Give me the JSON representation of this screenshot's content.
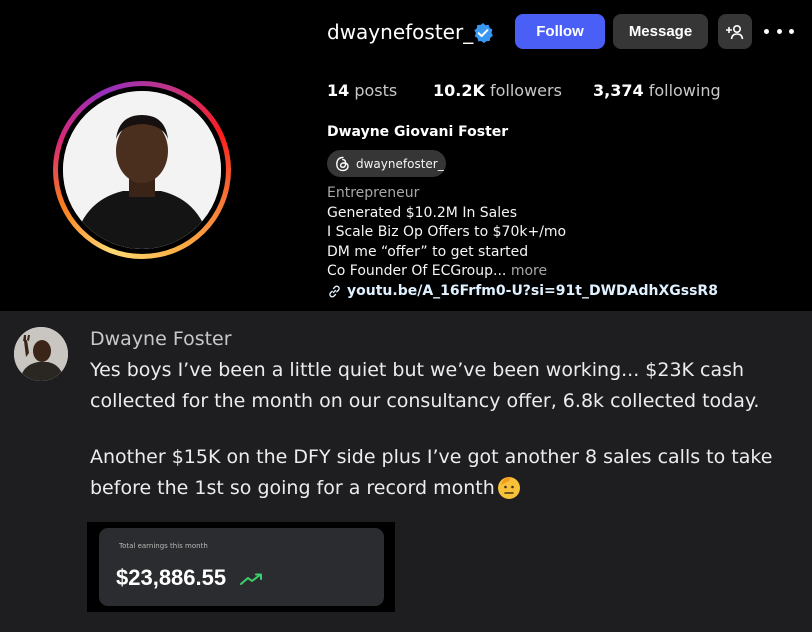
{
  "profile": {
    "username": "dwaynefoster_",
    "follow_label": "Follow",
    "message_label": "Message",
    "stats": {
      "posts_count": "14",
      "posts_label": "posts",
      "followers_count": "10.2K",
      "followers_label": "followers",
      "following_count": "3,374",
      "following_label": "following"
    },
    "full_name": "Dwayne Giovani Foster",
    "threads_handle": "dwaynefoster_",
    "bio": {
      "category": "Entrepreneur",
      "line1": "Generated $10.2M In Sales",
      "line2": "I Scale Biz Op Offers to $70k+/mo",
      "line3": "DM me “offer” to get started",
      "line4": "Co Founder Of ECGroup...",
      "more_label": "more"
    },
    "link": "youtu.be/A_16Frfm0-U?si=91t_DWDAdhXGssR8"
  },
  "post": {
    "author": "Dwayne Foster",
    "paragraph1": "Yes boys I’ve been a little quiet but we’ve been working... $23K cash collected for the month on our consultancy offer, 6.8k collected today.",
    "paragraph2": "Another $15K on the DFY side plus I’ve got another 8 sales calls to take before the 1st so going for a record month",
    "earnings_card": {
      "label": "Total earnings this month",
      "amount": "$23,886.55"
    }
  },
  "icons": {
    "verified": "verified-badge-icon",
    "suggest": "add-person-icon",
    "more": "more-options-icon",
    "threads": "threads-icon",
    "link": "link-icon",
    "emoji": "saluting-face-emoji",
    "trend": "trend-up-icon"
  },
  "colors": {
    "follow_button": "#4a5ff6",
    "secondary_button": "#363636",
    "verified": "#3897f0",
    "trend": "#3ecf6d",
    "post_background": "#1e1e21"
  }
}
